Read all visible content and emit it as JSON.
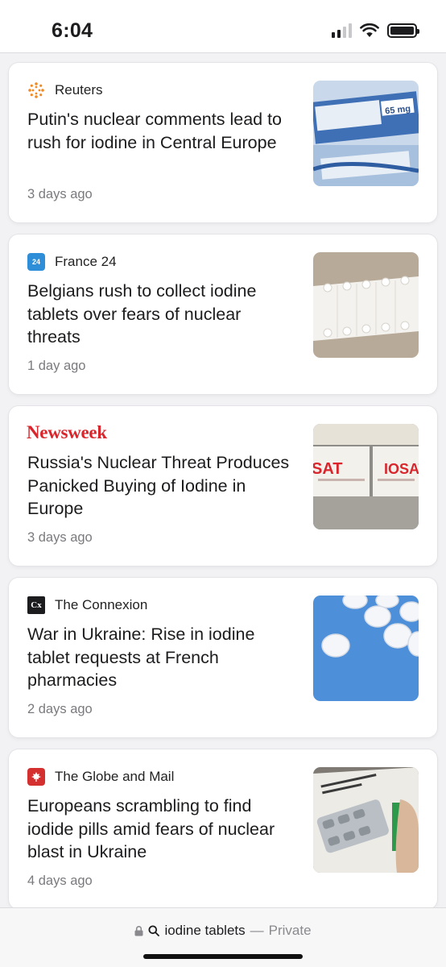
{
  "status_bar": {
    "time": "6:04"
  },
  "articles": [
    {
      "source": "Reuters",
      "headline": "Putin's nuclear comments lead to rush for iodine in Central Europe",
      "time": "3 days ago",
      "thumb_text": "65 mg"
    },
    {
      "source": "France 24",
      "headline": "Belgians rush to collect iodine tablets over fears of nuclear threats",
      "time": "1 day ago",
      "logo_text": "24"
    },
    {
      "source": "Newsweek",
      "headline": "Russia's Nuclear Threat Produces Panicked Buying of Iodine in Europe",
      "time": "3 days ago",
      "thumb_text_left": "SAT",
      "thumb_text_right": "IOSAT"
    },
    {
      "source": "The Connexion",
      "headline": "War in Ukraine: Rise in iodine tablet requests at French pharmacies",
      "time": "2 days ago",
      "logo_text": "Cx"
    },
    {
      "source": "The Globe and Mail",
      "headline": "Europeans scrambling to find iodide pills amid fears of nuclear blast in Ukraine",
      "time": "4 days ago"
    }
  ],
  "address_bar": {
    "query": "iodine tablets",
    "separator": "—",
    "mode": "Private"
  },
  "colors": {
    "newsweek_red": "#d8262c",
    "globe_red": "#d3302f",
    "france24_blue": "#2f8ed8",
    "reuters_orange": "#f08a24"
  },
  "icons": [
    "signal-icon",
    "wifi-icon",
    "battery-icon",
    "lock-icon",
    "search-icon"
  ]
}
